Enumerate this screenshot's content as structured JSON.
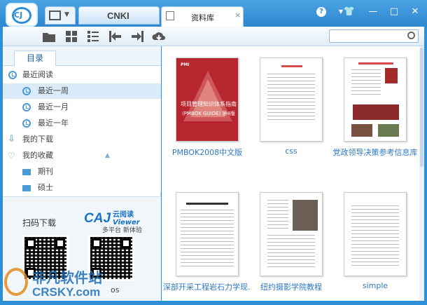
{
  "tabs": {
    "cnki": "CNKI",
    "library": "资料库",
    "close": "×"
  },
  "window": {
    "help": "?",
    "minimize": "—",
    "maximize": "□",
    "close": "✕",
    "skin": "👕"
  },
  "toolbar": {
    "search_placeholder": ""
  },
  "sidebar": {
    "tab": "目录",
    "recent": "最近阅读",
    "recent_items": [
      "最近一周",
      "最近一月",
      "最近一年"
    ],
    "downloads": "我的下载",
    "favorites": "我的收藏",
    "favorite_items": [
      "期刊",
      "硕士"
    ],
    "scan_label": "扫码下载",
    "caj_logo": "CAJ",
    "caj_cn": "云阅读",
    "caj_en": "Viewer",
    "caj_tagline": "多平台 新体验",
    "platform_label": "os"
  },
  "documents": [
    {
      "name": "PMBOK2008中文版",
      "cover_title": "项目管理知识体系指南",
      "cover_sub": "(PMBOK GUIDE) 第4版"
    },
    {
      "name": "css"
    },
    {
      "name": "党政领导决策参考信息库"
    },
    {
      "name": "深部开采工程岩石力学现..."
    },
    {
      "name": "纽约摄影学院教程"
    },
    {
      "name": "simple"
    }
  ],
  "watermark": {
    "line1": "非凡软件站",
    "line2": "CRSKY.com"
  },
  "colors": {
    "accent": "#2f8fd6",
    "link": "#2d78bf",
    "pmbok_red": "#b5262f"
  }
}
